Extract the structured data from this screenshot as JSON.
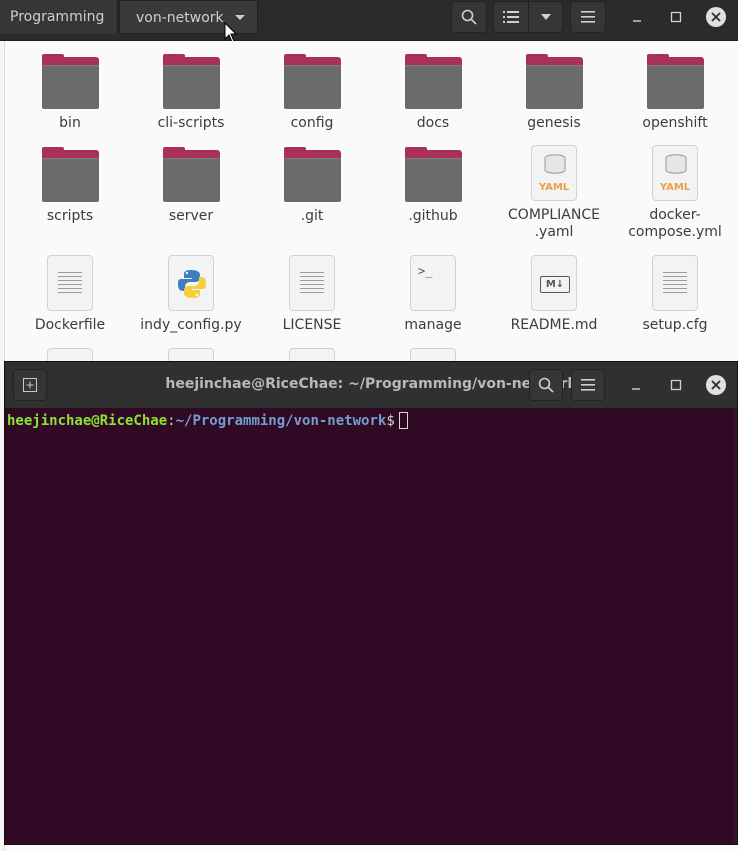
{
  "file_manager": {
    "breadcrumbs": [
      "Programming",
      "von-network"
    ],
    "items": [
      {
        "name": "bin",
        "type": "folder"
      },
      {
        "name": "cli-scripts",
        "type": "folder"
      },
      {
        "name": "config",
        "type": "folder"
      },
      {
        "name": "docs",
        "type": "folder"
      },
      {
        "name": "genesis",
        "type": "folder"
      },
      {
        "name": "openshift",
        "type": "folder"
      },
      {
        "name": "scripts",
        "type": "folder"
      },
      {
        "name": "server",
        "type": "folder"
      },
      {
        "name": ".git",
        "type": "folder"
      },
      {
        "name": ".github",
        "type": "folder"
      },
      {
        "name": "COMPLIANCE\n.yaml",
        "type": "yaml"
      },
      {
        "name": "docker-\ncompose.yml",
        "type": "yaml"
      },
      {
        "name": "Dockerfile",
        "type": "text"
      },
      {
        "name": "indy_config.py",
        "type": "python"
      },
      {
        "name": "LICENSE",
        "type": "text"
      },
      {
        "name": "manage",
        "type": "script"
      },
      {
        "name": "README.md",
        "type": "markdown"
      },
      {
        "name": "setup.cfg",
        "type": "text"
      }
    ]
  },
  "terminal": {
    "title": "heejinchae@RiceChae: ~/Programming/von-network",
    "prompt_user": "heejinchae@RiceChae",
    "prompt_sep": ":",
    "prompt_path": "~/Programming/von-network",
    "prompt_dollar": "$"
  },
  "icons": {
    "yaml_label": "YAML",
    "md_label": "M↓",
    "script_label": ">_"
  },
  "colors": {
    "folder_tab": "#a8305a",
    "terminal_bg": "#300a24",
    "prompt_user": "#8ae234",
    "prompt_path": "#729fcf"
  }
}
